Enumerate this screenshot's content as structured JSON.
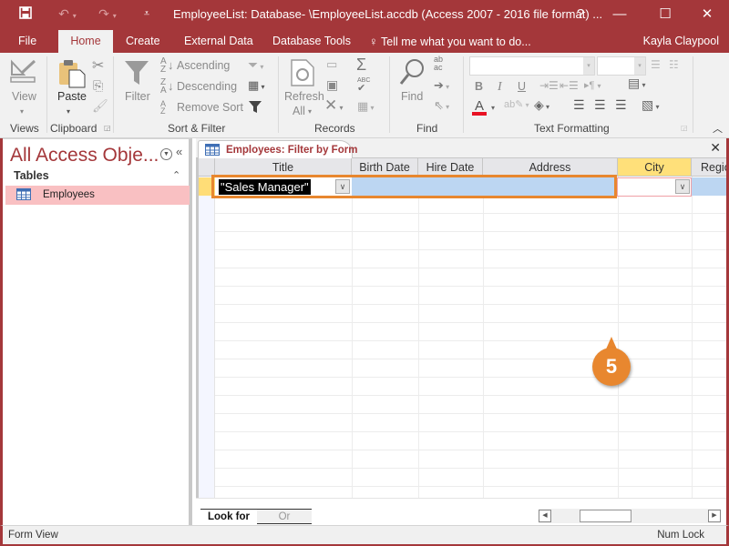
{
  "window": {
    "title": "EmployeeList: Database- \\EmployeeList.accdb (Access 2007 - 2016 file format) ...",
    "help_label": "?",
    "minimize_label": "—",
    "maximize_label": "☐",
    "close_label": "✕"
  },
  "quick_access": {
    "save_icon": "save-icon",
    "undo_icon": "undo-icon",
    "redo_icon": "redo-icon",
    "customize_icon": "customize-qat-icon"
  },
  "ribbon_tabs": [
    {
      "label": "File",
      "active": false
    },
    {
      "label": "Home",
      "active": true
    },
    {
      "label": "Create",
      "active": false
    },
    {
      "label": "External Data",
      "active": false
    },
    {
      "label": "Database Tools",
      "active": false
    }
  ],
  "tell_me": {
    "placeholder": "Tell me what you want to do..."
  },
  "user": {
    "name": "Kayla Claypool"
  },
  "ribbon": {
    "views": {
      "label": "Views",
      "view_button": "View"
    },
    "clipboard": {
      "label": "Clipboard",
      "paste_button": "Paste"
    },
    "sort_filter": {
      "label": "Sort & Filter",
      "filter_button": "Filter",
      "ascending": "Ascending",
      "descending": "Descending",
      "remove_sort": "Remove Sort"
    },
    "records": {
      "label": "Records",
      "refresh_line1": "Refresh",
      "refresh_line2": "All"
    },
    "find": {
      "label": "Find",
      "find_button": "Find"
    },
    "text_formatting": {
      "label": "Text Formatting",
      "font_name": "",
      "font_size": "",
      "bold": "B",
      "italic": "I",
      "underline": "U",
      "font_color": "#e81123"
    }
  },
  "nav_pane": {
    "title": "All Access Obje...",
    "section": "Tables",
    "items": [
      {
        "label": "Employees",
        "selected": true
      }
    ]
  },
  "document": {
    "tab_label": "Employees: Filter by Form",
    "columns": [
      "Title",
      "Birth Date",
      "Hire Date",
      "Address",
      "City",
      "Regio"
    ],
    "selected_column": "City",
    "criteria": {
      "Title": "\"Sales Manager\"",
      "City": ""
    },
    "bottom_tabs": [
      {
        "label": "Look for",
        "active": true
      },
      {
        "label": "Or",
        "active": false
      }
    ]
  },
  "callout": {
    "step": "5",
    "color": "#e8872f"
  },
  "status": {
    "left": "Form View",
    "right": "Num Lock"
  },
  "colors": {
    "brand": "#a4373a",
    "highlight": "#e8872f",
    "criteria_fill": "#bcd6f2",
    "nav_selected": "#f9c0c2"
  }
}
